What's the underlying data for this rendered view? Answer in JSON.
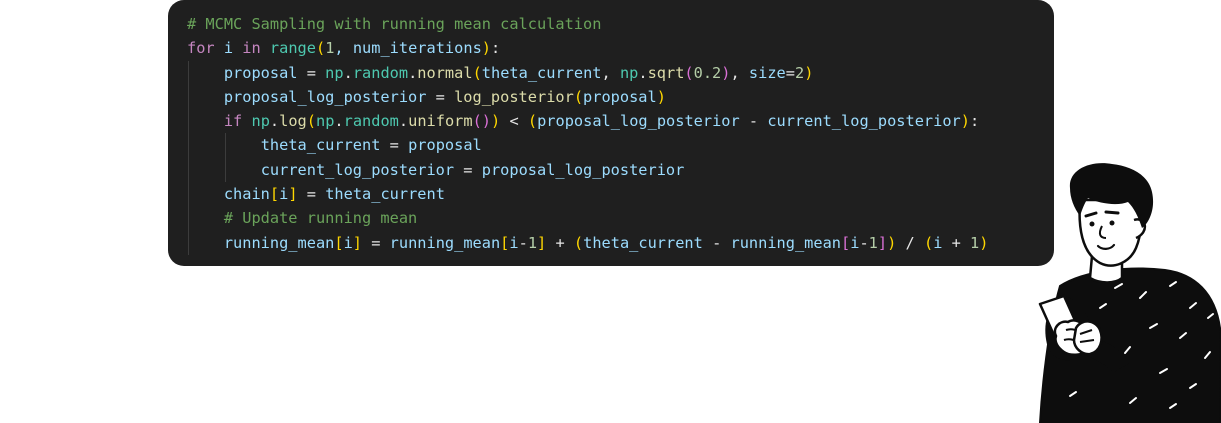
{
  "code": {
    "lines": [
      {
        "indent": 0,
        "tokens": [
          {
            "t": "# MCMC Sampling with running mean calculation",
            "k": "comment"
          }
        ]
      },
      {
        "indent": 0,
        "tokens": [
          {
            "t": "for",
            "k": "keyword"
          },
          {
            "t": " i ",
            "k": "var"
          },
          {
            "t": "in",
            "k": "keyword"
          },
          {
            "t": " ",
            "k": "plain"
          },
          {
            "t": "range",
            "k": "builtin"
          },
          {
            "t": "(",
            "k": "bracket1"
          },
          {
            "t": "1",
            "k": "number"
          },
          {
            "t": ", num_iterations",
            "k": "var"
          },
          {
            "t": ")",
            "k": "bracket1"
          },
          {
            "t": ":",
            "k": "plain"
          }
        ]
      },
      {
        "indent": 1,
        "tokens": [
          {
            "t": "proposal",
            "k": "var"
          },
          {
            "t": " = ",
            "k": "op"
          },
          {
            "t": "np",
            "k": "builtin"
          },
          {
            "t": ".",
            "k": "plain"
          },
          {
            "t": "random",
            "k": "builtin"
          },
          {
            "t": ".",
            "k": "plain"
          },
          {
            "t": "normal",
            "k": "func"
          },
          {
            "t": "(",
            "k": "bracket1"
          },
          {
            "t": "theta_current",
            "k": "var"
          },
          {
            "t": ", ",
            "k": "plain"
          },
          {
            "t": "np",
            "k": "builtin"
          },
          {
            "t": ".",
            "k": "plain"
          },
          {
            "t": "sqrt",
            "k": "func"
          },
          {
            "t": "(",
            "k": "bracket2"
          },
          {
            "t": "0.2",
            "k": "number"
          },
          {
            "t": ")",
            "k": "bracket2"
          },
          {
            "t": ", ",
            "k": "plain"
          },
          {
            "t": "size",
            "k": "var"
          },
          {
            "t": "=",
            "k": "op"
          },
          {
            "t": "2",
            "k": "number"
          },
          {
            "t": ")",
            "k": "bracket1"
          }
        ]
      },
      {
        "indent": 1,
        "tokens": [
          {
            "t": "proposal_log_posterior",
            "k": "var"
          },
          {
            "t": " = ",
            "k": "op"
          },
          {
            "t": "log_posterior",
            "k": "func"
          },
          {
            "t": "(",
            "k": "bracket1"
          },
          {
            "t": "proposal",
            "k": "var"
          },
          {
            "t": ")",
            "k": "bracket1"
          }
        ]
      },
      {
        "indent": 1,
        "tokens": [
          {
            "t": "if",
            "k": "keyword"
          },
          {
            "t": " ",
            "k": "plain"
          },
          {
            "t": "np",
            "k": "builtin"
          },
          {
            "t": ".",
            "k": "plain"
          },
          {
            "t": "log",
            "k": "func"
          },
          {
            "t": "(",
            "k": "bracket1"
          },
          {
            "t": "np",
            "k": "builtin"
          },
          {
            "t": ".",
            "k": "plain"
          },
          {
            "t": "random",
            "k": "builtin"
          },
          {
            "t": ".",
            "k": "plain"
          },
          {
            "t": "uniform",
            "k": "func"
          },
          {
            "t": "(",
            "k": "bracket2"
          },
          {
            "t": ")",
            "k": "bracket2"
          },
          {
            "t": ")",
            "k": "bracket1"
          },
          {
            "t": " < ",
            "k": "op"
          },
          {
            "t": "(",
            "k": "bracket1"
          },
          {
            "t": "proposal_log_posterior",
            "k": "var"
          },
          {
            "t": " - ",
            "k": "op"
          },
          {
            "t": "current_log_posterior",
            "k": "var"
          },
          {
            "t": ")",
            "k": "bracket1"
          },
          {
            "t": ":",
            "k": "plain"
          }
        ]
      },
      {
        "indent": 2,
        "tokens": [
          {
            "t": "theta_current",
            "k": "var"
          },
          {
            "t": " = ",
            "k": "op"
          },
          {
            "t": "proposal",
            "k": "var"
          }
        ]
      },
      {
        "indent": 2,
        "tokens": [
          {
            "t": "current_log_posterior",
            "k": "var"
          },
          {
            "t": " = ",
            "k": "op"
          },
          {
            "t": "proposal_log_posterior",
            "k": "var"
          }
        ]
      },
      {
        "indent": 1,
        "tokens": [
          {
            "t": "chain",
            "k": "var"
          },
          {
            "t": "[",
            "k": "bracket1"
          },
          {
            "t": "i",
            "k": "var"
          },
          {
            "t": "]",
            "k": "bracket1"
          },
          {
            "t": " = ",
            "k": "op"
          },
          {
            "t": "theta_current",
            "k": "var"
          }
        ]
      },
      {
        "indent": 1,
        "tokens": [
          {
            "t": "# Update running mean",
            "k": "comment"
          }
        ]
      },
      {
        "indent": 1,
        "tokens": [
          {
            "t": "running_mean",
            "k": "var"
          },
          {
            "t": "[",
            "k": "bracket1"
          },
          {
            "t": "i",
            "k": "var"
          },
          {
            "t": "]",
            "k": "bracket1"
          },
          {
            "t": " = ",
            "k": "op"
          },
          {
            "t": "running_mean",
            "k": "var"
          },
          {
            "t": "[",
            "k": "bracket1"
          },
          {
            "t": "i",
            "k": "var"
          },
          {
            "t": "-",
            "k": "op"
          },
          {
            "t": "1",
            "k": "number"
          },
          {
            "t": "]",
            "k": "bracket1"
          },
          {
            "t": " + ",
            "k": "op"
          },
          {
            "t": "(",
            "k": "bracket1"
          },
          {
            "t": "theta_current",
            "k": "var"
          },
          {
            "t": " - ",
            "k": "op"
          },
          {
            "t": "running_mean",
            "k": "var"
          },
          {
            "t": "[",
            "k": "bracket2"
          },
          {
            "t": "i",
            "k": "var"
          },
          {
            "t": "-",
            "k": "op"
          },
          {
            "t": "1",
            "k": "number"
          },
          {
            "t": "]",
            "k": "bracket2"
          },
          {
            "t": ")",
            "k": "bracket1"
          },
          {
            "t": " / ",
            "k": "op"
          },
          {
            "t": "(",
            "k": "bracket1"
          },
          {
            "t": "i",
            "k": "var"
          },
          {
            "t": " + ",
            "k": "op"
          },
          {
            "t": "1",
            "k": "number"
          },
          {
            "t": ")",
            "k": "bracket1"
          }
        ]
      }
    ]
  },
  "colors": {
    "panel_background": "#1f1f1f",
    "comment": "#6aa35a",
    "keyword": "#c586c0",
    "function": "#dcdcaa",
    "variable": "#9cdcfe"
  },
  "illustration": {
    "icon": "man-reading-phone-illustration"
  }
}
